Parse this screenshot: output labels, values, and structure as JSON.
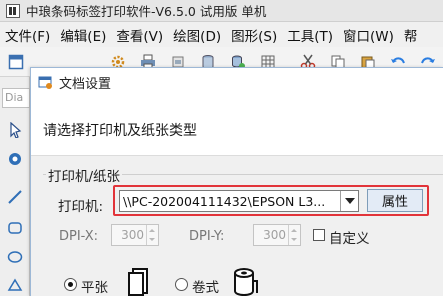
{
  "app": {
    "title": "中琅条码标签打印软件-V6.5.0 试用版 单机"
  },
  "menu": {
    "items": [
      "文件(F)",
      "编辑(E)",
      "查看(V)",
      "绘图(D)",
      "图形(S)",
      "工具(T)",
      "窗口(W)",
      "帮"
    ]
  },
  "toolbar": {
    "partial_input_text": "Dia"
  },
  "dialog": {
    "title": "文档设置",
    "subtitle": "请选择打印机及纸张类型",
    "group_label": "打印机/纸张",
    "printer_label": "打印机:",
    "printer_value": "\\\\PC-202004111432\\EPSON L3...",
    "properties_button": "属性",
    "dpi_x_label": "DPI-X:",
    "dpi_x_value": "300",
    "dpi_y_label": "DPI-Y:",
    "dpi_y_value": "300",
    "custom_label": "自定义",
    "custom_checked": false,
    "paper_types": [
      {
        "label": "平张",
        "selected": true,
        "icon": "flat-paper-icon"
      },
      {
        "label": "卷式",
        "selected": false,
        "icon": "paper-roll-icon"
      }
    ]
  },
  "colors": {
    "highlight": "#e2343a",
    "dialog_border": "#9db8d6",
    "button_bg": "#e3ebf6"
  }
}
